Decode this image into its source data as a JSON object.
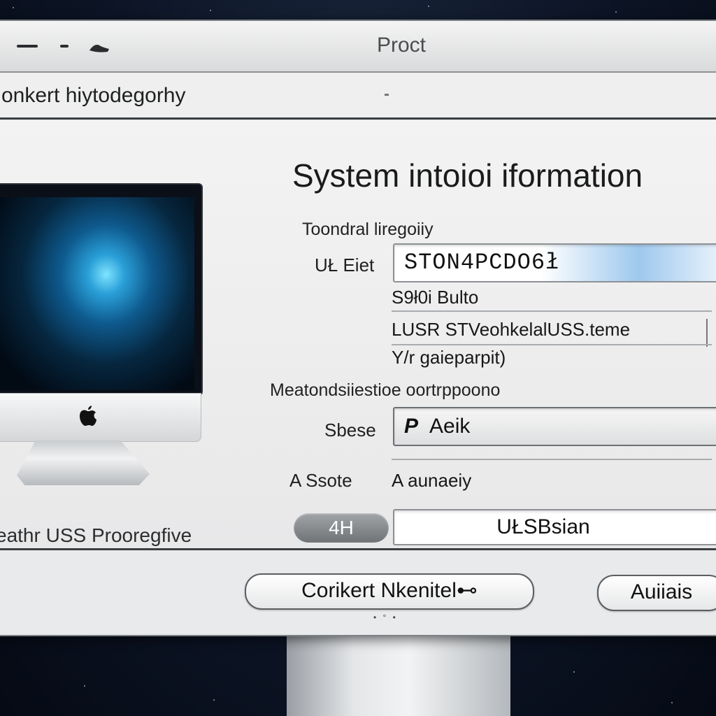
{
  "window": {
    "title": "Proct"
  },
  "pathbar": {
    "text": "onkert hiytodegorhy"
  },
  "illustration": {
    "caption": "eathr USS Prooregfive"
  },
  "info": {
    "heading": "System intoioi iformation",
    "subheading": "Toondral liregoiiy",
    "serial_label": "UŁ Eiet",
    "serial_value": "STON4PCDO6ł",
    "line1": "S9ł0i Bulto",
    "line2": "LUSR STVeohkelalUSS.teme",
    "line3": "Y/r gaieparpit)",
    "status_heading": "Meatondsiiestioe oortrppoono",
    "status_label": "Sbese",
    "status_icon_glyph": "P",
    "status_value": "Aeik",
    "assurance_label": "A Ssote",
    "assurance_value": "A aunaeiy",
    "pill_label": "4H",
    "region_value": "UŁSBsian"
  },
  "footer": {
    "primary_button": "Corikert Nkenitel⊷",
    "secondary_button": "Auiiais",
    "dots": "• ° •"
  },
  "colors": {
    "window_bg": "#e9eaeb",
    "field_highlight": "#9ec8ee",
    "pill": "#8a8d90"
  }
}
